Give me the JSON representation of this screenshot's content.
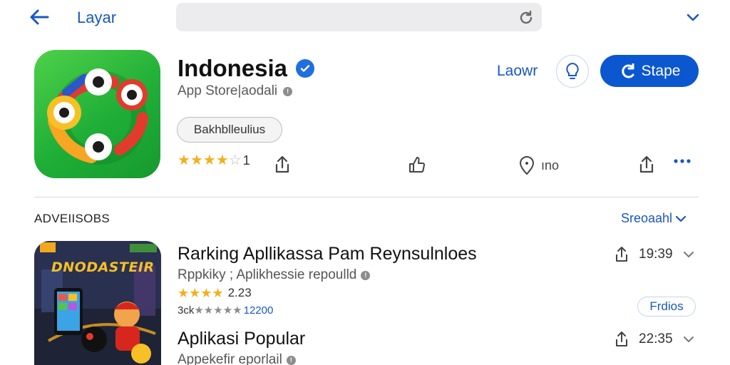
{
  "topbar": {
    "title": "Layar",
    "back_icon": "arrow-left-icon",
    "refresh_icon": "refresh-icon",
    "chevron_icon": "chevron-down-icon"
  },
  "app": {
    "name": "Indonesia",
    "store": "App Store|aodali",
    "chip": "Bakhblleulius",
    "rating_stars": 4,
    "rating_suffix": "1",
    "link_label": "Laowr",
    "primary_button": "Stape",
    "actions": [
      {
        "icon": "thumbs-up-icon",
        "label": ""
      },
      {
        "icon": "map-pin-icon",
        "label": "ıno"
      },
      {
        "icon": "share-icon",
        "label": ""
      }
    ]
  },
  "section": {
    "title": "ADVEIISOBS",
    "more_label": "Sreoaahl"
  },
  "rows": [
    {
      "title": "Rarking Apllikassa Pam Reynsulnloes",
      "subtitle": "Rppkiky ; Aplikhessie repoulld",
      "rating_stars": 4,
      "rating_value": "2.23",
      "meta_prefix": "3ck",
      "meta_value": "12200",
      "time": "19:39",
      "tag": "Frdios",
      "thumb_title": "DNODASTEIR"
    },
    {
      "title": "Aplikasi Popular",
      "subtitle": "Appekefir eporlail",
      "time": "22:35"
    }
  ],
  "colors": {
    "accent": "#1a56c4",
    "primary_button": "#0b57d0",
    "star": "#f2b01e",
    "app_icon_green": "#1fae37"
  }
}
